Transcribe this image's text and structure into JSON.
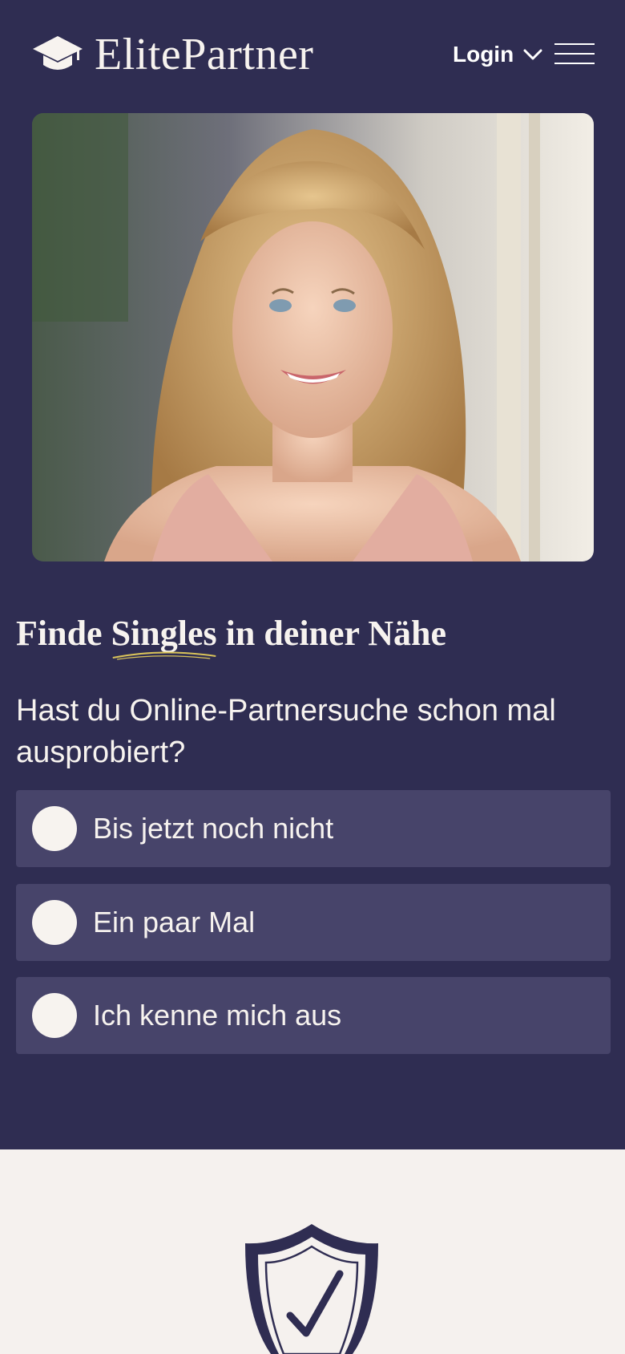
{
  "header": {
    "logo_text": "ElitePartner",
    "logo_icon": "graduation-cap-icon",
    "login_label": "Login",
    "login_icon": "chevron-down-icon",
    "menu_icon": "hamburger-menu-icon"
  },
  "hero": {
    "photo_alt": "smiling-woman-photo",
    "headline_before": "Finde ",
    "headline_highlight": "Singles",
    "headline_after": " in deiner Nähe",
    "question": "Hast du Online-Partnersuche schon mal ausprobiert?",
    "options": [
      {
        "label": "Bis jetzt noch nicht"
      },
      {
        "label": "Ein paar Mal"
      },
      {
        "label": "Ich kenne mich aus"
      }
    ]
  },
  "trust": {
    "icon": "shield-check-icon"
  },
  "colors": {
    "navy": "#2f2d52",
    "option_bg": "#47446a",
    "cream": "#f5f1ee",
    "accent_gold": "#d9c35a"
  }
}
